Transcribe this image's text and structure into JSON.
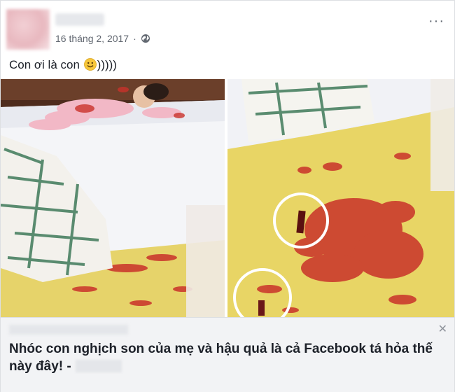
{
  "post": {
    "date": "16 tháng 2, 2017",
    "separator": "·",
    "privacy_icon": "globe-icon",
    "more_icon": "ellipsis-icon",
    "more_label": "···",
    "text_before": "Con ơi là con ",
    "emoji": "smile-icon",
    "text_after": ")))))"
  },
  "link": {
    "close_label": "✕",
    "title": "Nhóc con nghịch son của mẹ và hậu quả là cả Facebook tá hỏa thế này đây! -"
  },
  "colors": {
    "lipstick": "#c9322a",
    "carpet": "#e9d569",
    "sheet": "#f7f7f9",
    "blanket_pattern": "#3f7a5a"
  }
}
